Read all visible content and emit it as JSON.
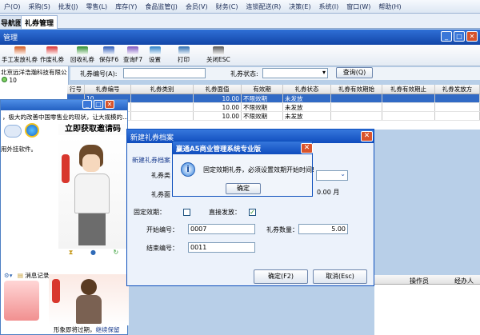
{
  "menu": [
    "户(O)",
    "采购(S)",
    "批发(J)",
    "零售(L)",
    "库存(Y)",
    "食品监管(J)",
    "会员(V)",
    "财务(C)",
    "连锁配送(R)",
    "决策(E)",
    "系统(I)",
    "窗口(W)",
    "帮助(H)"
  ],
  "tabs": [
    "导航图",
    "礼券管理"
  ],
  "module_title": "管理",
  "toolbar": [
    {
      "label": "手工发放礼券",
      "color": "#d25a1e"
    },
    {
      "label": "作废礼券",
      "color": "#d83030"
    },
    {
      "label": "回收礼券",
      "color": "#2d8d2d"
    },
    {
      "label": "保存F6",
      "color": "#2857b8"
    },
    {
      "label": "查询F7",
      "color": "#7b54c0"
    },
    {
      "label": "设置",
      "color": "#2a7fc6"
    },
    {
      "label": "打印",
      "color": "#2a6bb0"
    },
    {
      "label": "关闭ESC",
      "color": "#555555"
    }
  ],
  "left_panel": {
    "company": "北京远洋浩瀚科技有限公",
    "count": "10"
  },
  "filter": {
    "code_label": "礼券编号(A):",
    "status_label": "礼券状态:",
    "query_label": "查询(Q)"
  },
  "grid": {
    "columns": [
      "行号",
      "礼券编号",
      "礼券类别",
      "礼券面值",
      "有效期",
      "礼券状态",
      "礼券有效期始",
      "礼券有效期止",
      "礼券发放方"
    ],
    "rows": [
      [
        "",
        "10",
        "",
        "10.00",
        "不限效期",
        "未发放",
        "",
        "",
        ""
      ],
      [
        "",
        "10",
        "",
        "10.00",
        "不限效期",
        "未发放",
        "",
        "",
        ""
      ],
      [
        "",
        "10",
        "",
        "10.00",
        "不限效期",
        "未发放",
        "",
        "",
        ""
      ]
    ]
  },
  "bottom_grid": {
    "col1": "操作员",
    "col2": "经办人"
  },
  "im": {
    "news": "，极大的改善中国零售业的现状，让大规模的...",
    "plugin": "用外挂软件。",
    "invite": "立即获取邀请码",
    "history": "消息记录",
    "footer": "形象即将过期，",
    "renew": "继续保留"
  },
  "dialog": {
    "title": "新建礼券档案",
    "section": "新建礼券档案",
    "type_label": "礼券类",
    "face_label": "礼券面",
    "face_value": "0.00",
    "unit": "月",
    "fixed_label": "固定效期：",
    "direct_label": "直接发放：",
    "start_label": "开始编号：",
    "start_value": "0007",
    "qty_label": "礼券数量：",
    "qty_value": "5.00",
    "end_label": "结束编号：",
    "end_value": "0011",
    "ok": "确定(F2)",
    "cancel": "取消(Esc)"
  },
  "alert": {
    "title": "赢通A5商业管理系统专业版",
    "message": "固定效期礼券，必须设置效期开始时间!",
    "ok": "确定"
  }
}
